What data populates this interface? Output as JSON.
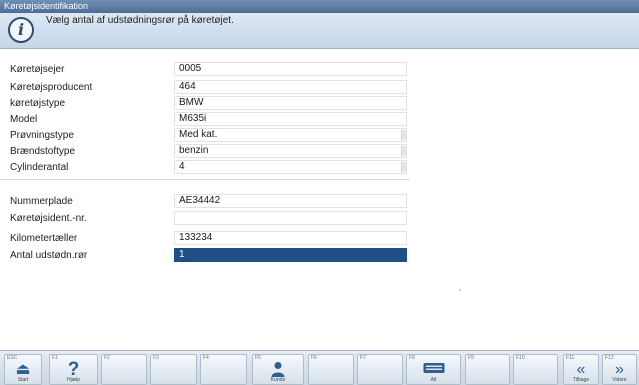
{
  "window": {
    "title": "Køretøjsidentifikation"
  },
  "info": {
    "message": "Vælg antal af udstødningsrør på køretøjet."
  },
  "form": {
    "rows": [
      {
        "label": "Køretøjsejer",
        "value": "0005"
      },
      {
        "label": "Køretøjsproducent",
        "value": "464"
      },
      {
        "label": "køretøjstype",
        "value": "BMW"
      },
      {
        "label": "Model",
        "value": "M635i"
      },
      {
        "label": "Prøvningstype",
        "value": "Med kat."
      },
      {
        "label": "Brændstoftype",
        "value": "benzin"
      },
      {
        "label": "Cylinderantal",
        "value": "4"
      },
      {
        "label": "Nummerplade",
        "value": "AE34442"
      },
      {
        "label": "Køretøjsident.-nr.",
        "value": ""
      },
      {
        "label": "Kilometertæller",
        "value": "133234"
      },
      {
        "label": "Antal udstødn.rør",
        "value": "1"
      }
    ]
  },
  "fkeys": [
    {
      "key": "ESC",
      "icon": "eject-icon",
      "caption": "Start"
    },
    {
      "key": "F1",
      "icon": "help-icon",
      "caption": "Hjælp"
    },
    {
      "key": "F2",
      "icon": "",
      "caption": ""
    },
    {
      "key": "F3",
      "icon": "",
      "caption": ""
    },
    {
      "key": "F4",
      "icon": "",
      "caption": ""
    },
    {
      "key": "F5",
      "icon": "customer-icon",
      "caption": "Kunde"
    },
    {
      "key": "F6",
      "icon": "",
      "caption": ""
    },
    {
      "key": "F7",
      "icon": "",
      "caption": ""
    },
    {
      "key": "F8",
      "icon": "keyboard-icon",
      "caption": "Alt"
    },
    {
      "key": "F9",
      "icon": "",
      "caption": ""
    },
    {
      "key": "F10",
      "icon": "",
      "caption": ""
    },
    {
      "key": "F11",
      "icon": "previous-icon",
      "caption": "Tilbage"
    },
    {
      "key": "F12",
      "icon": "next-icon",
      "caption": "Videre"
    }
  ],
  "colors": {
    "title_bar": "#4d6d94",
    "info_bar": "#c6d6e8",
    "selected_field": "#1f4f84",
    "icon_blue": "#2d5f93"
  }
}
